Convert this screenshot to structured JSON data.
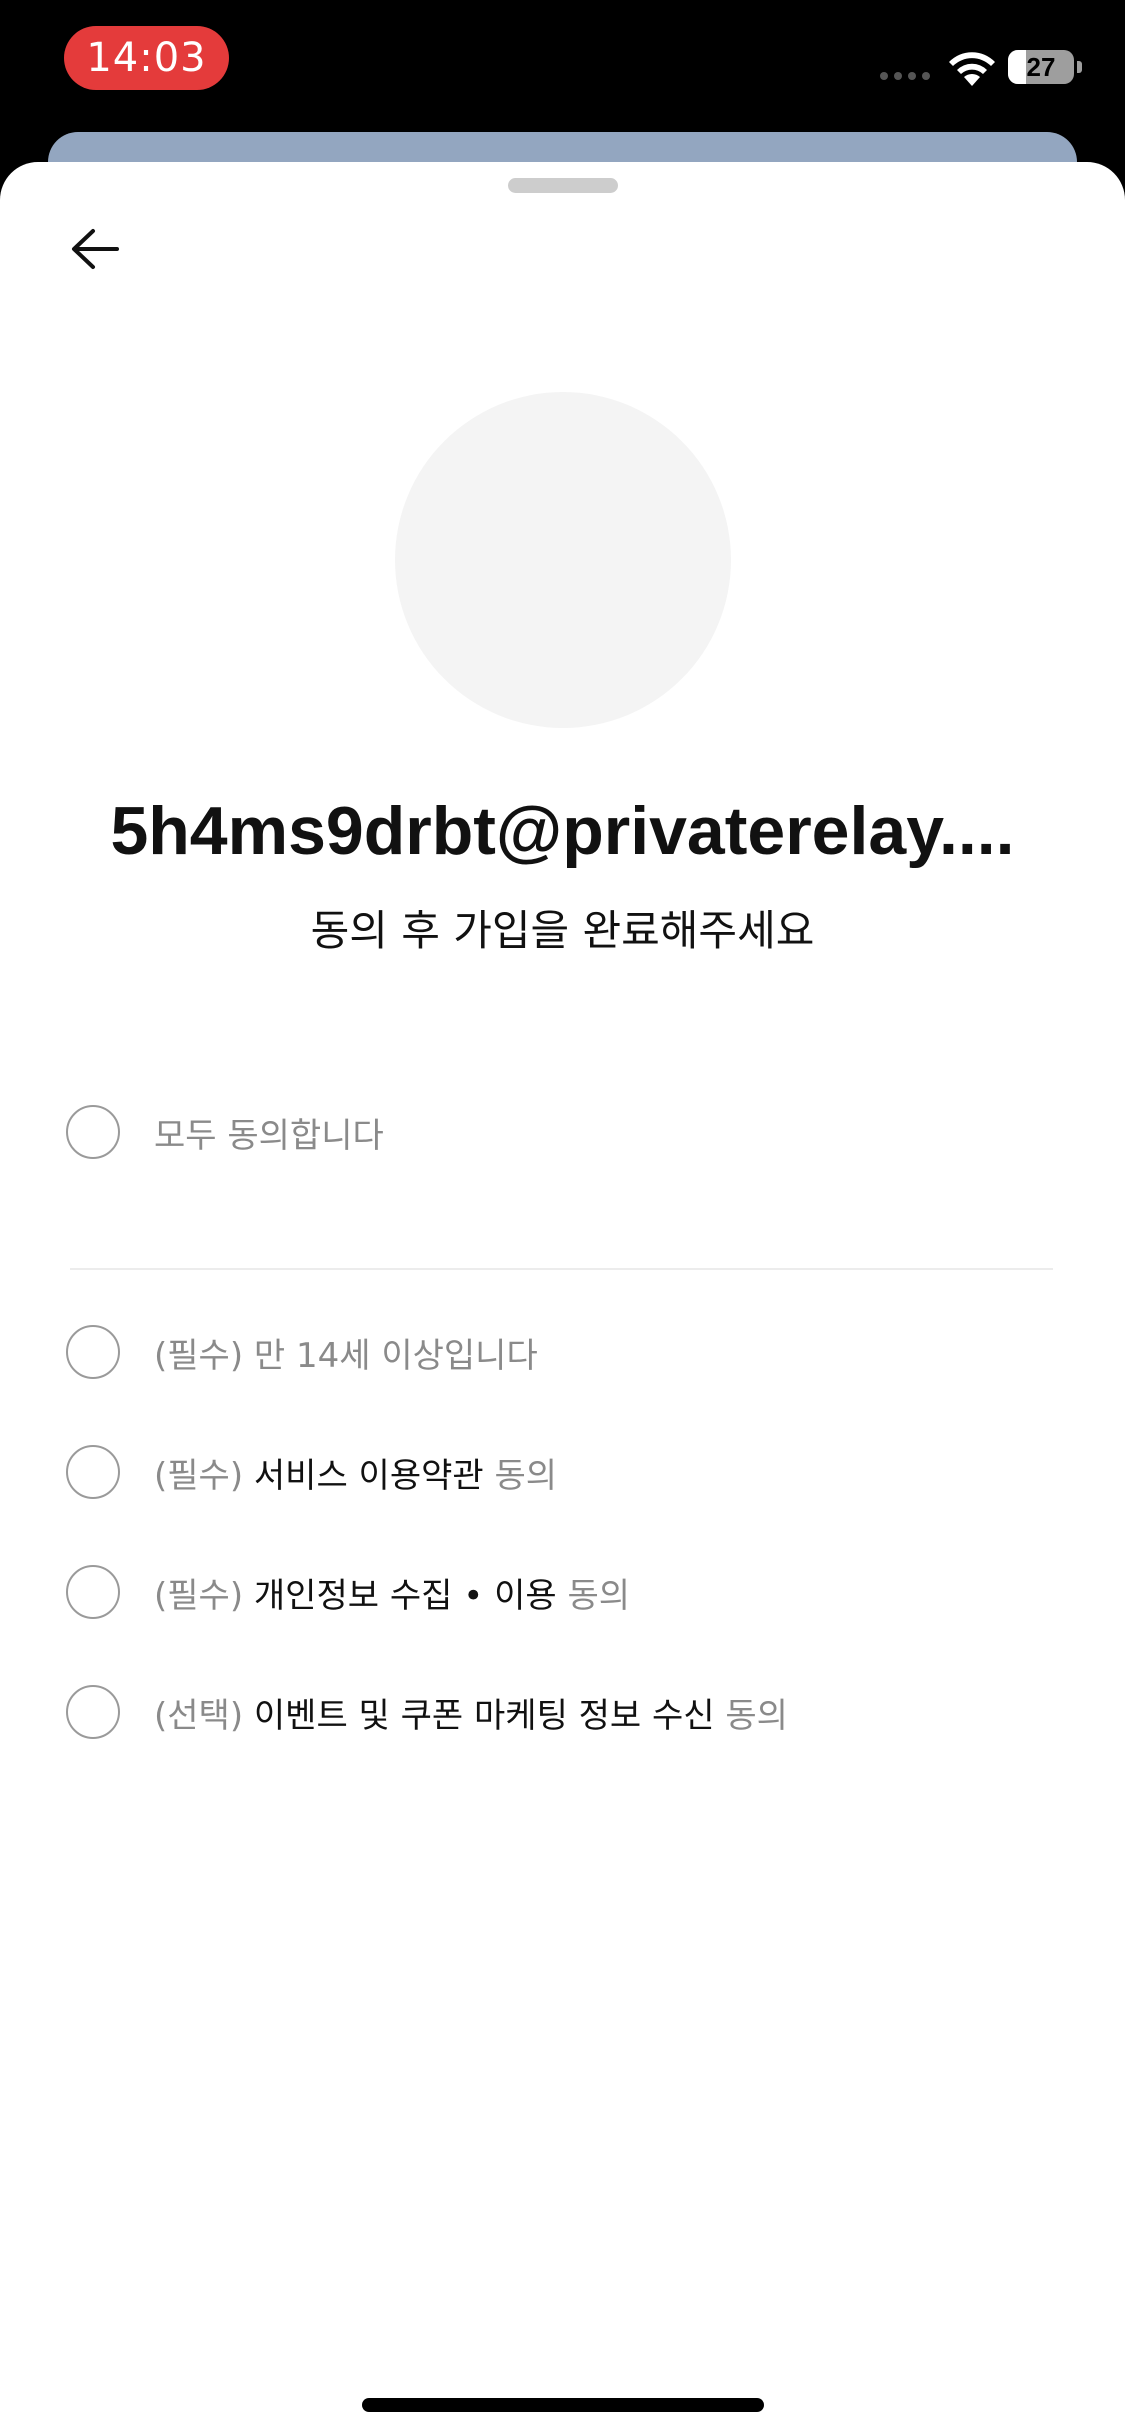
{
  "status_bar": {
    "time": "14:03",
    "battery_level": "27",
    "battery_fraction": 0.27
  },
  "header": {
    "back_icon": "arrow-left-icon"
  },
  "profile": {
    "email": "5h4ms9drbt@privaterelay....",
    "subtitle": "동의 후 가입을 완료해주세요"
  },
  "agreements": {
    "all": "모두 동의합니다",
    "items": [
      {
        "prefix": "(필수)",
        "main": "",
        "suffix": "만 14세 이상입니다"
      },
      {
        "prefix": "(필수)",
        "main": "서비스 이용약관",
        "suffix": "동의"
      },
      {
        "prefix": "(필수)",
        "main": "개인정보 수집 • 이용",
        "suffix": "동의"
      },
      {
        "prefix": "(선택)",
        "main": "이벤트 및 쿠폰 마케팅 정보 수신",
        "suffix": "동의"
      }
    ]
  },
  "colors": {
    "time_pill": "#e43b3b",
    "muted_text": "#8a8a8a",
    "primary_text": "#111111"
  }
}
